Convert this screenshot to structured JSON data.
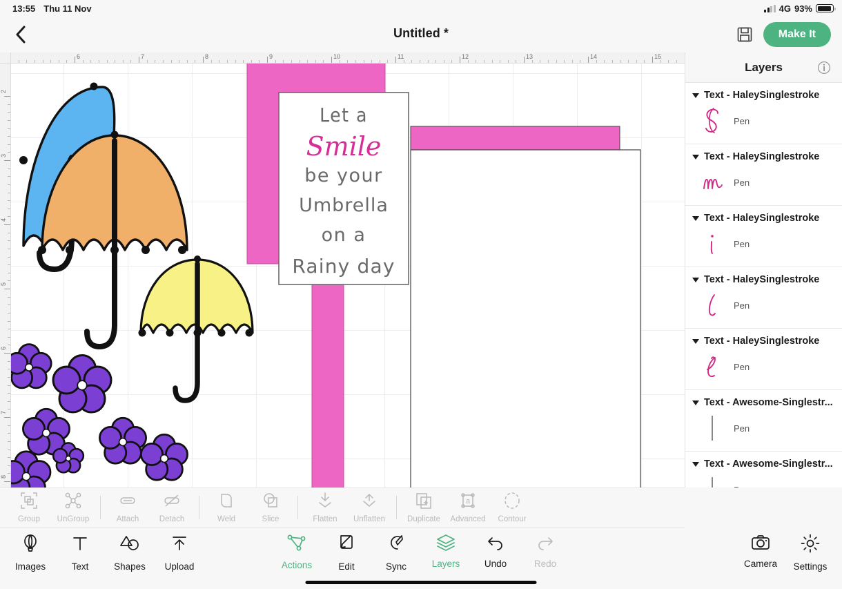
{
  "statusbar": {
    "time": "13:55",
    "date": "Thu 11 Nov",
    "network": "4G",
    "battery": "93%",
    "battery_level": 93
  },
  "topnav": {
    "back_icon": "chevron-left-icon",
    "title": "Untitled *",
    "save_icon": "save-floppy-icon",
    "make_it_label": "Make It",
    "accent_green": "#4db381"
  },
  "canvas": {
    "ruler_h_labels": [
      "6",
      "7",
      "8",
      "9",
      "10",
      "11",
      "12",
      "13",
      "14",
      "15"
    ],
    "ruler_v_labels": [
      "2",
      "3",
      "4",
      "5",
      "6",
      "7",
      "8"
    ],
    "card_text_lines": [
      "Let a",
      "Smile",
      "be your",
      "Umbrella",
      "on a",
      "Rainy day"
    ],
    "card_accent_word": "Smile",
    "colors": {
      "pink": "#ee66c4",
      "umbrella_blue": "#5cb4f0",
      "umbrella_orange": "#f0b069",
      "umbrella_yellow": "#f8f286",
      "flower_purple": "#7b3fd4",
      "script_pink": "#d62e96",
      "text_grey": "#6a6a6a"
    }
  },
  "layers": {
    "title": "Layers",
    "info_icon": "info-circle-icon",
    "groups": [
      {
        "name": "Text - HaleySinglestroke",
        "glyph": "S",
        "child_label": "Pen"
      },
      {
        "name": "Text - HaleySinglestroke",
        "glyph": "m",
        "child_label": "Pen"
      },
      {
        "name": "Text - HaleySinglestroke",
        "glyph": "i",
        "child_label": "Pen"
      },
      {
        "name": "Text - HaleySinglestroke",
        "glyph": "l",
        "child_label": "Pen"
      },
      {
        "name": "Text - HaleySinglestroke",
        "glyph": "e",
        "child_label": "Pen"
      },
      {
        "name": "Text - Awesome-Singlestr...",
        "glyph": "bar",
        "child_label": "Pen"
      },
      {
        "name": "Text - Awesome-Singlestr...",
        "glyph": "bar",
        "child_label": "Pen"
      }
    ]
  },
  "op_toolbar": {
    "items": [
      {
        "label": "Group",
        "icon": "group-icon"
      },
      {
        "label": "UnGroup",
        "icon": "ungroup-icon"
      },
      {
        "label": "Attach",
        "icon": "attach-icon"
      },
      {
        "label": "Detach",
        "icon": "detach-icon"
      },
      {
        "label": "Weld",
        "icon": "weld-icon"
      },
      {
        "label": "Slice",
        "icon": "slice-icon"
      },
      {
        "label": "Flatten",
        "icon": "flatten-icon"
      },
      {
        "label": "Unflatten",
        "icon": "unflatten-icon"
      },
      {
        "label": "Duplicate",
        "icon": "duplicate-icon"
      },
      {
        "label": "Advanced",
        "icon": "advanced-icon"
      },
      {
        "label": "Contour",
        "icon": "contour-icon"
      }
    ]
  },
  "bottom_bar": {
    "left": [
      {
        "label": "Images",
        "icon": "balloon-icon"
      },
      {
        "label": "Text",
        "icon": "text-t-icon"
      },
      {
        "label": "Shapes",
        "icon": "shapes-icon"
      },
      {
        "label": "Upload",
        "icon": "upload-icon"
      }
    ],
    "center": [
      {
        "label": "Actions",
        "icon": "actions-nodes-icon",
        "state": "accent"
      },
      {
        "label": "Edit",
        "icon": "edit-pencil-icon",
        "state": "normal"
      },
      {
        "label": "Sync",
        "icon": "sync-pen-icon",
        "state": "normal"
      },
      {
        "label": "Layers",
        "icon": "layers-stack-icon",
        "state": "accent"
      },
      {
        "label": "Undo",
        "icon": "undo-arrow-icon",
        "state": "normal"
      },
      {
        "label": "Redo",
        "icon": "redo-arrow-icon",
        "state": "disabled"
      }
    ],
    "right": [
      {
        "label": "Camera",
        "icon": "camera-icon"
      },
      {
        "label": "Settings",
        "icon": "gear-icon"
      }
    ]
  }
}
